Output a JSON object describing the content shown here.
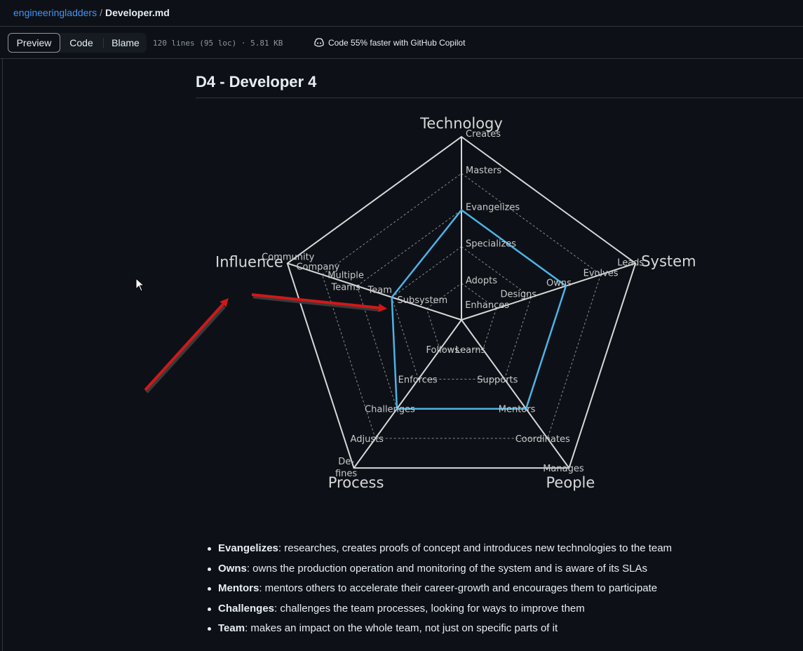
{
  "breadcrumb": {
    "repo": "engineeringladders",
    "separator": "/",
    "file": "Developer.md"
  },
  "toolbar": {
    "tabs": [
      "Preview",
      "Code",
      "Blame"
    ],
    "active_tab": "Preview",
    "file_meta": "120 lines (95 loc) · 5.81 KB",
    "copilot_text": "Code 55% faster with GitHub Copilot",
    "copilot_icon": "copilot-icon"
  },
  "page": {
    "heading": "D4 - Developer 4"
  },
  "colors": {
    "level_polygon": "#4db3e6",
    "arrow": "#d01818",
    "accent_link": "#4493f8"
  },
  "chart_data": {
    "type": "radar",
    "axes": [
      {
        "name": "Technology",
        "levels": [
          "Adopts",
          "Specializes",
          "Evangelizes",
          "Masters",
          "Creates"
        ]
      },
      {
        "name": "System",
        "levels": [
          "Enhances",
          "Designs",
          "Owns",
          "Evolves",
          "Leads"
        ]
      },
      {
        "name": "People",
        "levels": [
          "Learns",
          "Supports",
          "Mentors",
          "Coordinates",
          "Manages"
        ]
      },
      {
        "name": "Process",
        "levels": [
          "Follows",
          "Enforces",
          "Challenges",
          "Adjusts",
          "De-\nfines"
        ]
      },
      {
        "name": "Influence",
        "levels": [
          "Subsystem",
          "Team",
          "Multiple\nTeams",
          "Company",
          "Community"
        ]
      }
    ],
    "max_level": 5,
    "grid": true,
    "selected_levels": {
      "Technology": 3,
      "System": 3,
      "People": 3,
      "Process": 3,
      "Influence": 2
    }
  },
  "definitions": [
    {
      "term": "Evangelizes",
      "text": " researches, creates proofs of concept and introduces new technologies to the team"
    },
    {
      "term": "Owns",
      "text": " owns the production operation and monitoring of the system and is aware of its SLAs"
    },
    {
      "term": "Mentors",
      "text": " mentors others to accelerate their career-growth and encourages them to participate"
    },
    {
      "term": "Challenges",
      "text": " challenges the team processes, looking for ways to improve them"
    },
    {
      "term": "Team",
      "text": " makes an impact on the whole team, not just on specific parts of it"
    }
  ]
}
